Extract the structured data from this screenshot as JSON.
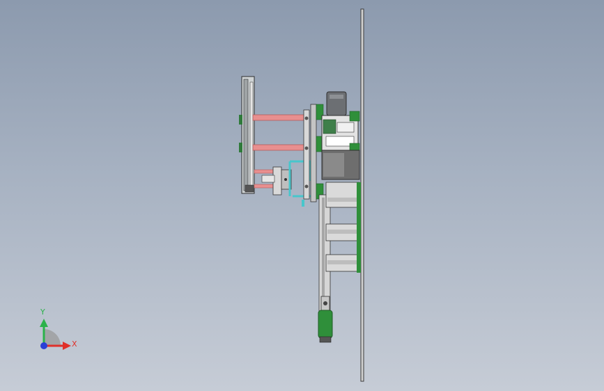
{
  "viewport": {
    "background_top": "#8c9aae",
    "background_bottom": "#c6ccd6"
  },
  "triad": {
    "x_label": "X",
    "y_label": "Y",
    "x_color": "#e0302a",
    "y_color": "#2bb24a",
    "z_color": "#2a3fd6"
  },
  "model": {
    "rod_color": "#e88f8f",
    "cylinder_color": "#2f8f3a",
    "plate_color": "#d6d6d6",
    "accent_color": "#48c6cc",
    "motor_color": "#6c6f73"
  }
}
